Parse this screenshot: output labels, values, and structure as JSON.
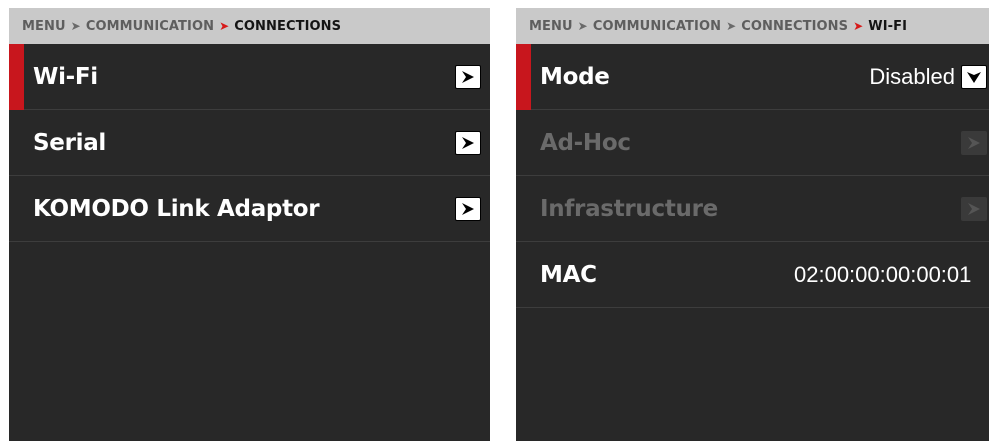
{
  "left": {
    "breadcrumb": {
      "parts": [
        "MENU",
        "COMMUNICATION"
      ],
      "current": "CONNECTIONS"
    },
    "items": [
      {
        "label": "Wi-Fi",
        "selected": true,
        "icon": "chevron-right-icon"
      },
      {
        "label": "Serial",
        "selected": false,
        "icon": "chevron-right-icon"
      },
      {
        "label": "KOMODO Link Adaptor",
        "selected": false,
        "icon": "chevron-right-icon"
      }
    ]
  },
  "right": {
    "breadcrumb": {
      "parts": [
        "MENU",
        "COMMUNICATION",
        "CONNECTIONS"
      ],
      "current": "WI-FI"
    },
    "mode": {
      "label": "Mode",
      "value": "Disabled",
      "icon": "chevron-down-icon"
    },
    "adhoc": {
      "label": "Ad-Hoc",
      "disabled": true,
      "icon": "chevron-right-icon"
    },
    "infrastructure": {
      "label": "Infrastructure",
      "disabled": true,
      "icon": "chevron-right-icon"
    },
    "mac": {
      "label": "MAC",
      "value": "02:00:00:00:00:01"
    }
  },
  "colors": {
    "accent": "#c8161d",
    "breadcrumb_bg": "#c9c9c9",
    "panel_bg": "#282828",
    "disabled_text": "#6a6a6a"
  }
}
